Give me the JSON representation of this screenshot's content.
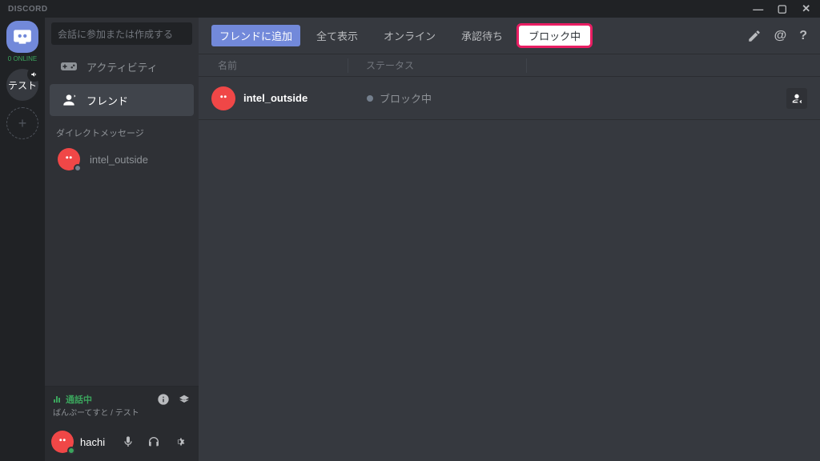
{
  "app_title": "DISCORD",
  "window": {
    "min": "—",
    "max": "▢",
    "close": "✕"
  },
  "server_rail": {
    "online_label": "0 ONLINE",
    "text_server": "テスト",
    "add": "+"
  },
  "sidebar": {
    "search_placeholder": "会話に参加または作成する",
    "items": [
      {
        "label": "アクティビティ"
      },
      {
        "label": "フレンド"
      }
    ],
    "dm_header": "ダイレクトメッセージ",
    "dm": [
      {
        "name": "intel_outside"
      }
    ],
    "voice": {
      "label": "通話中",
      "sub": "ばんぷーてすと / テスト"
    },
    "user": {
      "name": "hachi"
    }
  },
  "header": {
    "add_friend": "フレンドに追加",
    "tabs": [
      {
        "label": "全て表示"
      },
      {
        "label": "オンライン"
      },
      {
        "label": "承認待ち"
      },
      {
        "label": "ブロック中"
      }
    ]
  },
  "table": {
    "col_name": "名前",
    "col_status": "ステータス",
    "rows": [
      {
        "name": "intel_outside",
        "status": "ブロック中"
      }
    ]
  }
}
